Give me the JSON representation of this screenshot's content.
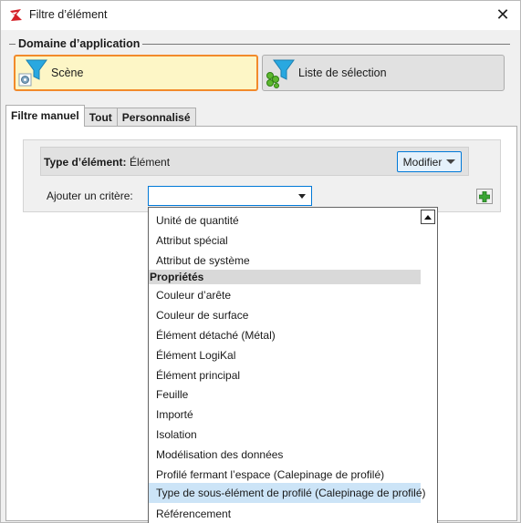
{
  "window": {
    "title": "Filtre d’élément",
    "close_glyph": "✕"
  },
  "scope": {
    "group_title": "Domaine d’application",
    "scene_label": "Scène",
    "list_label": "Liste de sélection",
    "scene_icon": "funnel-scene-icon",
    "list_icon": "funnel-list-icon",
    "accent_border": "#f28a2b",
    "selected_bg": "#fdf6c6"
  },
  "tabs": [
    {
      "label": "Filtre manuel",
      "active": true
    },
    {
      "label": "Tout",
      "active": false
    },
    {
      "label": "Personnalisé",
      "active": false
    }
  ],
  "criteria": {
    "type_label": "Type d’élément:",
    "type_value": "Élément",
    "modify_label": "Modifier",
    "add_label": "Ajouter un critère:",
    "combo_value": ""
  },
  "dropdown": {
    "items_top": [
      "Unité de quantité",
      "Attribut spécial",
      "Attribut de système"
    ],
    "header": "Propriétés",
    "items": [
      "Couleur d’arête",
      "Couleur de surface",
      "Élément détaché (Métal)",
      "Élément LogiKal",
      "Élément principal",
      "Feuille",
      "Importé",
      "Isolation",
      "Modélisation des données",
      "Profilé fermant l’espace (Calepinage de profilé)",
      "Type de sous-élément de profilé (Calepinage de profilé)",
      "Référencement"
    ],
    "hover_item": "Type de sous-élément de profilé (Calepinage de profilé)",
    "hover_color": "#cce4f7"
  }
}
